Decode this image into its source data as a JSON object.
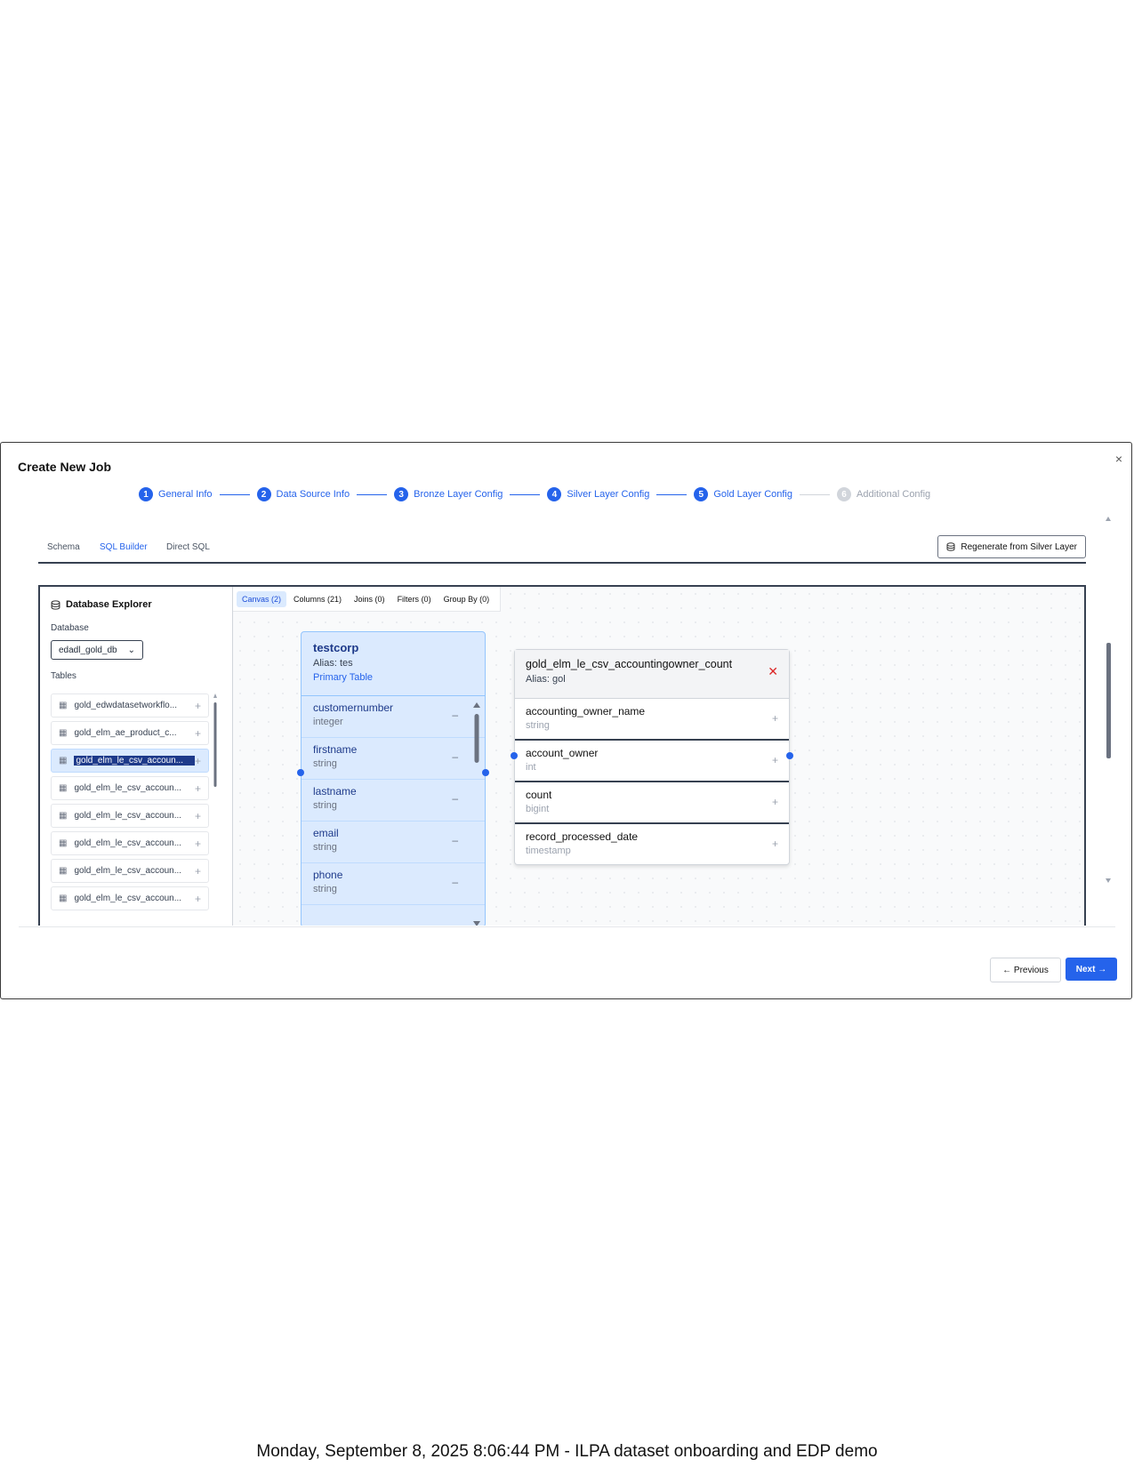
{
  "modal": {
    "title": "Create New Job",
    "close": "×",
    "steps": [
      {
        "num": "1",
        "label": "General Info"
      },
      {
        "num": "2",
        "label": "Data Source Info"
      },
      {
        "num": "3",
        "label": "Bronze Layer Config"
      },
      {
        "num": "4",
        "label": "Silver Layer Config"
      },
      {
        "num": "5",
        "label": "Gold Layer Config"
      },
      {
        "num": "6",
        "label": "Additional Config"
      }
    ],
    "subtabs": [
      "Schema",
      "SQL Builder",
      "Direct SQL"
    ],
    "active_subtab": "SQL Builder",
    "regenerate_label": "Regenerate from Silver Layer",
    "previous_label": "← Previous",
    "next_label": "Next →"
  },
  "explorer": {
    "title": "Database Explorer",
    "database_label": "Database",
    "database_value": "edadl_gold_db",
    "tables_label": "Tables",
    "tables": [
      "gold_edwdatasetworkflo...",
      "gold_elm_ae_product_c...",
      "gold_elm_le_csv_accoun...",
      "gold_elm_le_csv_accoun...",
      "gold_elm_le_csv_accoun...",
      "gold_elm_le_csv_accoun...",
      "gold_elm_le_csv_accoun...",
      "gold_elm_le_csv_accoun..."
    ],
    "selected_index": 2
  },
  "canvas_tabs": [
    "Canvas (2)",
    "Columns (21)",
    "Joins (0)",
    "Filters (0)",
    "Group By (0)"
  ],
  "node_primary": {
    "title": "testcorp",
    "alias": "Alias: tes",
    "badge": "Primary Table",
    "columns": [
      {
        "name": "customernumber",
        "type": "integer"
      },
      {
        "name": "firstname",
        "type": "string"
      },
      {
        "name": "lastname",
        "type": "string"
      },
      {
        "name": "email",
        "type": "string"
      },
      {
        "name": "phone",
        "type": "string"
      }
    ]
  },
  "node_secondary": {
    "title": "gold_elm_le_csv_accountingowner_count",
    "alias": "Alias: gol",
    "columns": [
      {
        "name": "accounting_owner_name",
        "type": "string"
      },
      {
        "name": "account_owner",
        "type": "int"
      },
      {
        "name": "count",
        "type": "bigint"
      },
      {
        "name": "record_processed_date",
        "type": "timestamp"
      }
    ]
  },
  "caption": "Monday, September 8, 2025 8:06:44 PM - ILPA dataset onboarding and EDP demo",
  "colors": {
    "accent": "#2563eb",
    "node_bg": "#dbeafe",
    "danger": "#dc2626"
  }
}
